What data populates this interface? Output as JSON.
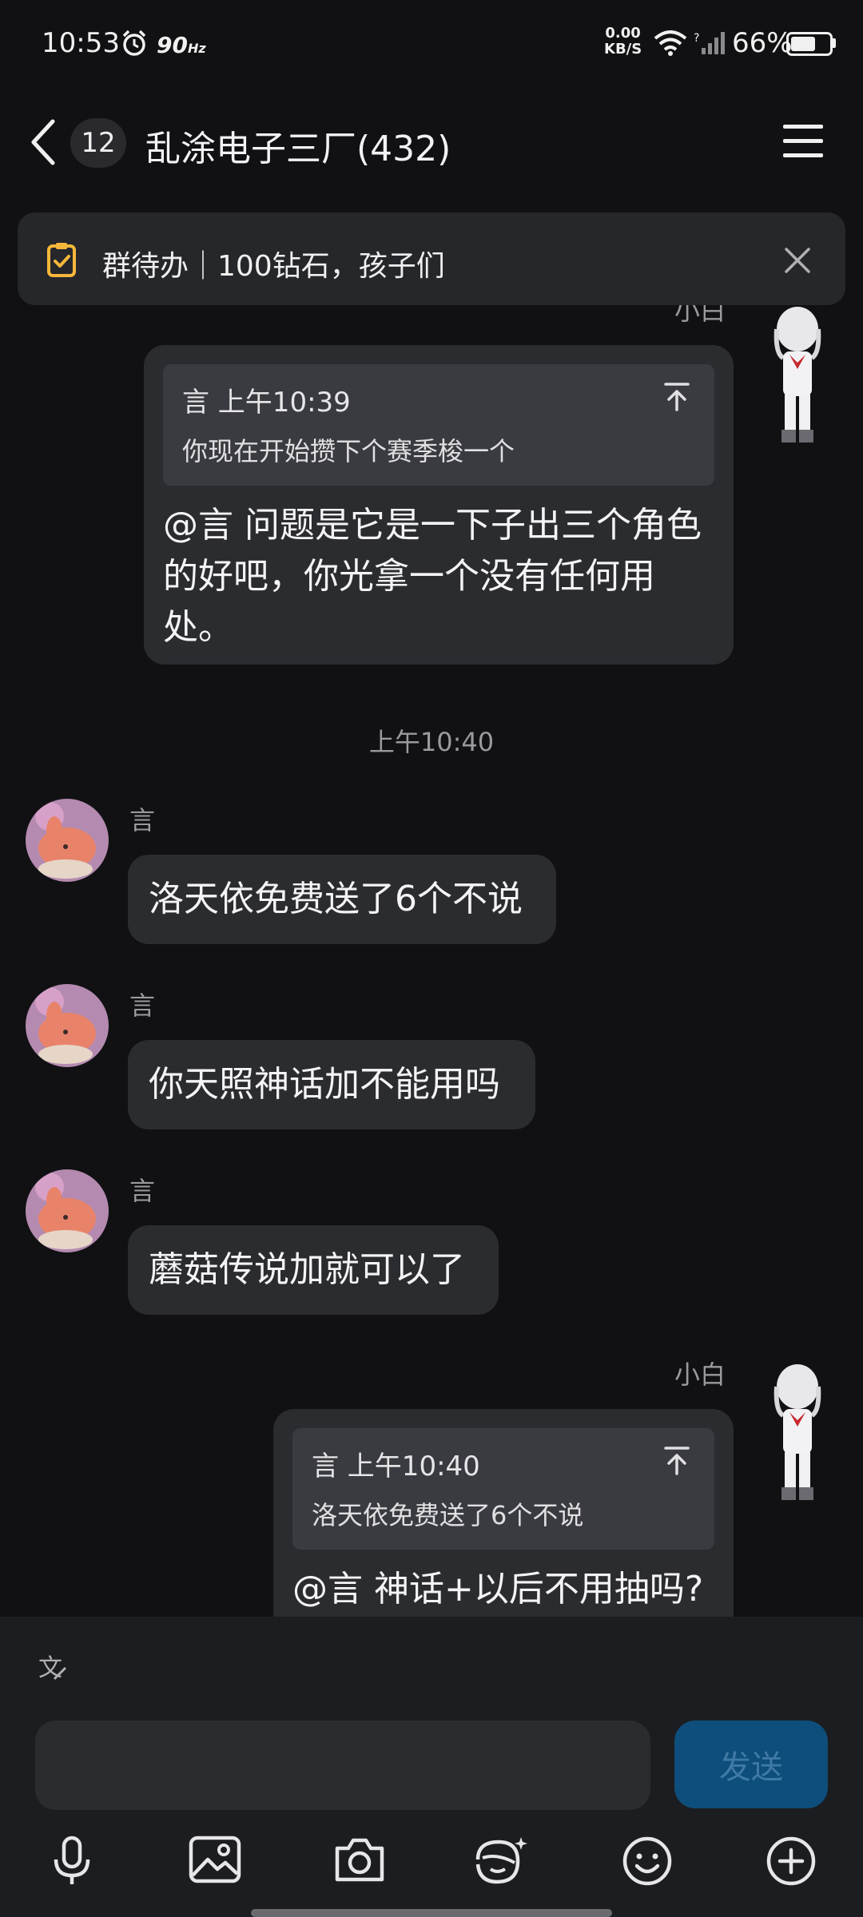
{
  "status_bar": {
    "time": "10:53",
    "refresh_rate": "90",
    "refresh_unit": "Hz",
    "speed_value": "0.00",
    "speed_unit": "KB/S",
    "battery_percent": "66%",
    "battery_level": 0.66,
    "icons": [
      "alarm-icon",
      "wifi-icon",
      "signal-icon",
      "battery-icon"
    ]
  },
  "header": {
    "unread_count": "12",
    "title": "乱涂电子三厂(432)",
    "icons": [
      "back-icon",
      "menu-icon"
    ]
  },
  "todo_banner": {
    "text": "群待办｜100钻石，孩子们",
    "icons": [
      "todo-icon",
      "close-icon"
    ]
  },
  "messages": [
    {
      "side": "right",
      "sender": "小白",
      "quote_author_time": "言 上午10:39",
      "quote_text": "你现在开始攒下个赛季梭一个",
      "lines": [
        "@言 问题是它是一下子出三个角色",
        "的好吧，你光拿一个没有任何用",
        "处。"
      ]
    },
    {
      "type": "timestamp",
      "text": "上午10:40"
    },
    {
      "side": "left",
      "sender": "言",
      "text": "洛天依免费送了6个不说"
    },
    {
      "side": "left",
      "sender": "言",
      "text": "你天照神话加不能用吗"
    },
    {
      "side": "left",
      "sender": "言",
      "text": "蘑菇传说加就可以了"
    },
    {
      "side": "right",
      "sender": "小白",
      "quote_author_time": "言 上午10:40",
      "quote_text": "洛天依免费送了6个不说",
      "text": "@言 神话+以后不用抽吗?"
    }
  ],
  "composer": {
    "input_value": "",
    "send_label": "发送",
    "icons": [
      "translate-icon",
      "microphone-icon",
      "image-icon",
      "camera-icon",
      "sticker-icon",
      "emoji-icon",
      "plus-icon"
    ]
  },
  "colors": {
    "background": "#111113",
    "bubble": "#2b2c30",
    "quote": "#3a3b40",
    "send_button": "#0e4e7c",
    "todo_icon": "#f5b73a"
  }
}
